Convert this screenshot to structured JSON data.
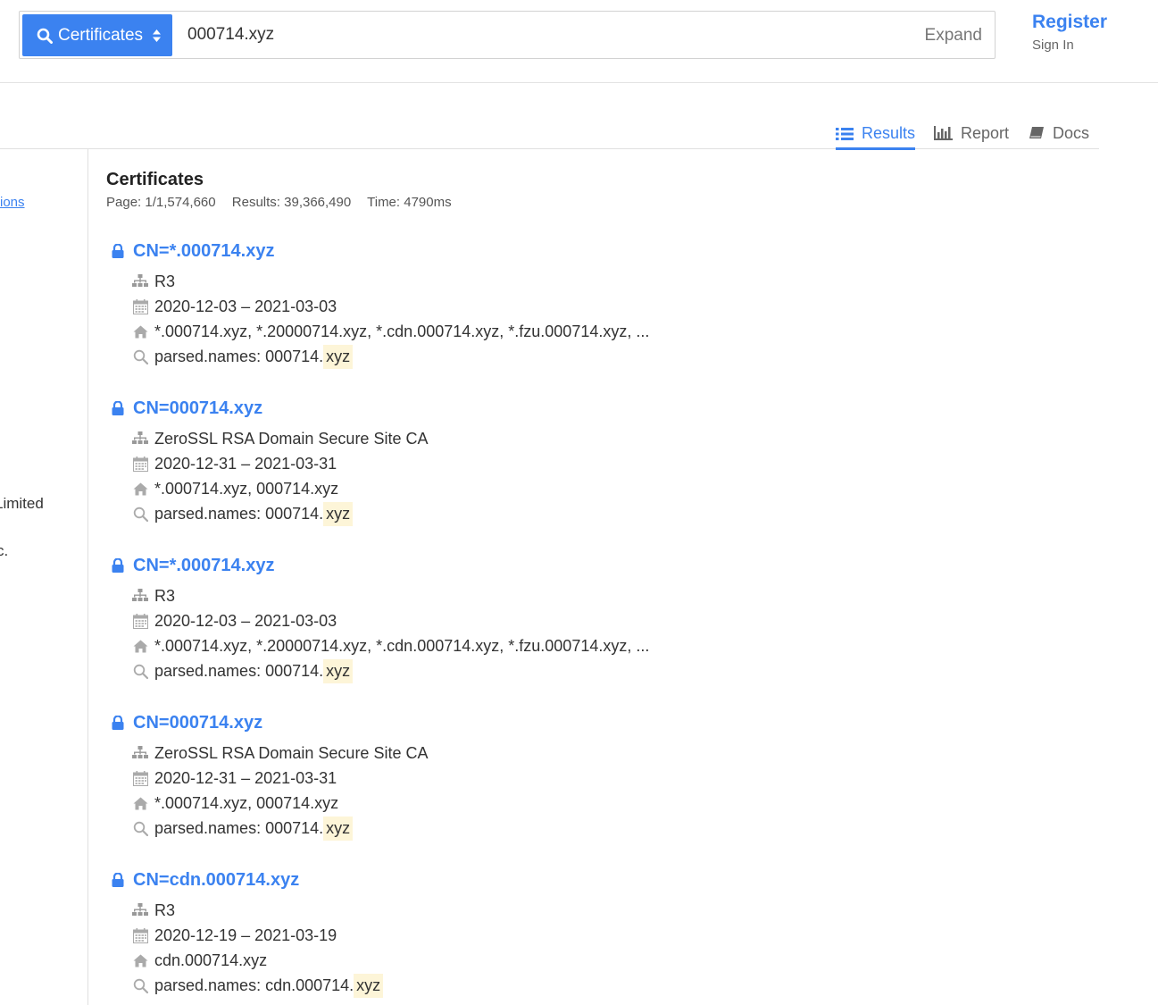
{
  "header": {
    "scope_label": "Certificates",
    "query": "000714.xyz",
    "expand_label": "Expand",
    "register_label": "Register",
    "signin_label": "Sign In"
  },
  "tabs": [
    {
      "label": "Results",
      "icon": "list-icon",
      "active": true
    },
    {
      "label": "Report",
      "icon": "bar-chart-icon",
      "active": false
    },
    {
      "label": "Docs",
      "icon": "book-icon",
      "active": false
    }
  ],
  "sidebar": {
    "fragments": [
      "ions",
      "Limited",
      "c.",
      "."
    ]
  },
  "main": {
    "title": "Certificates",
    "page": "Page: 1/1,574,660",
    "results": "Results: 39,366,490",
    "time": "Time: 4790ms"
  },
  "results": [
    {
      "cn": "CN=*.000714.xyz",
      "issuer": "R3",
      "validity": "2020-12-03 – 2021-03-03",
      "names": "*.000714.xyz, *.20000714.xyz, *.cdn.000714.xyz, *.fzu.000714.xyz, ...",
      "match_prefix": "parsed.names: 000714.",
      "match_hl": "xyz"
    },
    {
      "cn": "CN=000714.xyz",
      "issuer": "ZeroSSL RSA Domain Secure Site CA",
      "validity": "2020-12-31 – 2021-03-31",
      "names": "*.000714.xyz, 000714.xyz",
      "match_prefix": "parsed.names: 000714.",
      "match_hl": "xyz"
    },
    {
      "cn": "CN=*.000714.xyz",
      "issuer": "R3",
      "validity": "2020-12-03 – 2021-03-03",
      "names": "*.000714.xyz, *.20000714.xyz, *.cdn.000714.xyz, *.fzu.000714.xyz, ...",
      "match_prefix": "parsed.names: 000714.",
      "match_hl": "xyz"
    },
    {
      "cn": "CN=000714.xyz",
      "issuer": "ZeroSSL RSA Domain Secure Site CA",
      "validity": "2020-12-31 – 2021-03-31",
      "names": "*.000714.xyz, 000714.xyz",
      "match_prefix": "parsed.names: 000714.",
      "match_hl": "xyz"
    },
    {
      "cn": "CN=cdn.000714.xyz",
      "issuer": "R3",
      "validity": "2020-12-19 – 2021-03-19",
      "names": "cdn.000714.xyz",
      "match_prefix": "parsed.names: cdn.000714.",
      "match_hl": "xyz"
    }
  ],
  "colors": {
    "accent": "#3b82f0",
    "highlight": "#fdf5d8"
  }
}
